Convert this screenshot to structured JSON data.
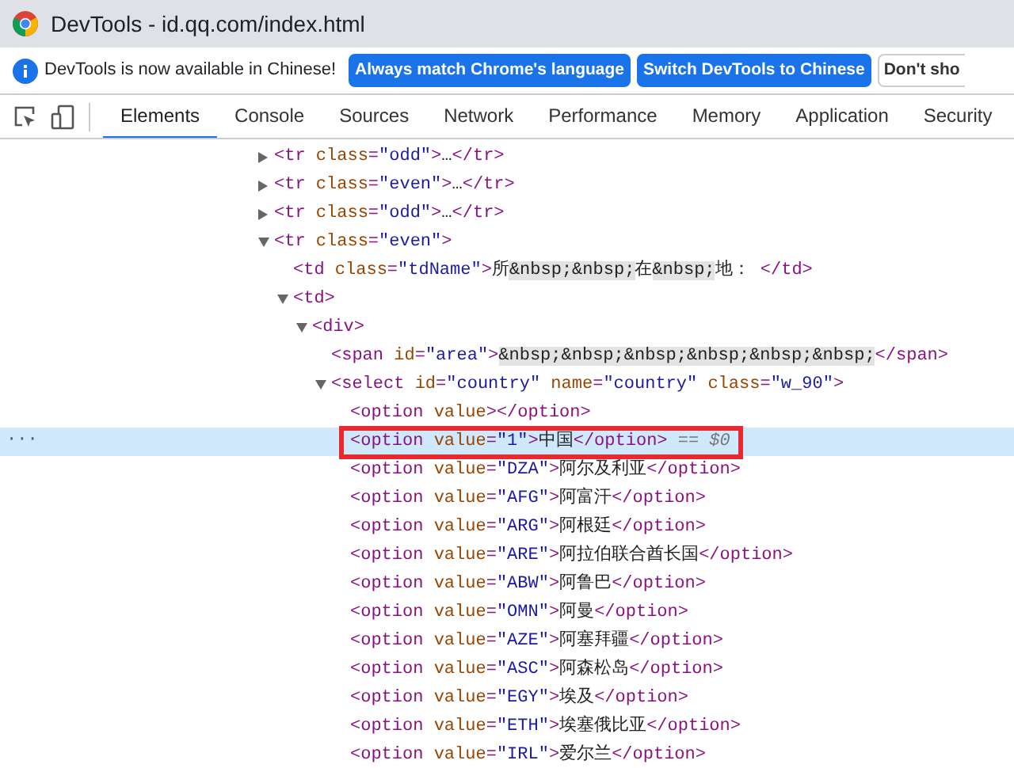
{
  "window": {
    "title": "DevTools - id.qq.com/index.html"
  },
  "infobar": {
    "message": "DevTools is now available in Chinese!",
    "buttons": [
      {
        "label": "Always match Chrome's language",
        "kind": "primary"
      },
      {
        "label": "Switch DevTools to Chinese",
        "kind": "primary"
      },
      {
        "label": "Don't sho",
        "kind": "plain"
      }
    ]
  },
  "tabs": [
    {
      "label": "Elements",
      "selected": true
    },
    {
      "label": "Console",
      "selected": false
    },
    {
      "label": "Sources",
      "selected": false
    },
    {
      "label": "Network",
      "selected": false
    },
    {
      "label": "Performance",
      "selected": false
    },
    {
      "label": "Memory",
      "selected": false
    },
    {
      "label": "Application",
      "selected": false
    },
    {
      "label": "Security",
      "selected": false
    }
  ],
  "tree": [
    {
      "selected": false,
      "expanded": false,
      "segments": [
        {
          "kind": "tag",
          "text": "<tr"
        },
        {
          "kind": "attr",
          "text": " class"
        },
        {
          "kind": "tag",
          "text": "="
        },
        {
          "kind": "value",
          "text": "\"odd\""
        },
        {
          "kind": "tag",
          "text": ">"
        },
        {
          "kind": "text",
          "text": "…"
        },
        {
          "kind": "tag",
          "text": "</tr>"
        }
      ]
    },
    {
      "selected": false,
      "expanded": false,
      "segments": [
        {
          "kind": "tag",
          "text": "<tr"
        },
        {
          "kind": "attr",
          "text": " class"
        },
        {
          "kind": "tag",
          "text": "="
        },
        {
          "kind": "value",
          "text": "\"even\""
        },
        {
          "kind": "tag",
          "text": ">"
        },
        {
          "kind": "text",
          "text": "…"
        },
        {
          "kind": "tag",
          "text": "</tr>"
        }
      ]
    },
    {
      "selected": false,
      "expanded": false,
      "segments": [
        {
          "kind": "tag",
          "text": "<tr"
        },
        {
          "kind": "attr",
          "text": " class"
        },
        {
          "kind": "tag",
          "text": "="
        },
        {
          "kind": "value",
          "text": "\"odd\""
        },
        {
          "kind": "tag",
          "text": ">"
        },
        {
          "kind": "text",
          "text": "…"
        },
        {
          "kind": "tag",
          "text": "</tr>"
        }
      ]
    },
    {
      "selected": false,
      "expanded": true,
      "segments": [
        {
          "kind": "tag",
          "text": "<tr"
        },
        {
          "kind": "attr",
          "text": " class"
        },
        {
          "kind": "tag",
          "text": "="
        },
        {
          "kind": "value",
          "text": "\"even\""
        },
        {
          "kind": "tag",
          "text": ">"
        }
      ],
      "children": [
        {
          "selected": false,
          "segments": [
            {
              "kind": "tag",
              "text": "<td"
            },
            {
              "kind": "attr",
              "text": " class"
            },
            {
              "kind": "tag",
              "text": "="
            },
            {
              "kind": "value",
              "text": "\"tdName\""
            },
            {
              "kind": "tag",
              "text": ">"
            },
            {
              "kind": "text",
              "text": "所"
            },
            {
              "kind": "entity",
              "text": "&nbsp;&nbsp;"
            },
            {
              "kind": "text",
              "text": "在"
            },
            {
              "kind": "entity",
              "text": "&nbsp;"
            },
            {
              "kind": "text",
              "text": "地： "
            },
            {
              "kind": "tag",
              "text": "</td>"
            }
          ]
        },
        {
          "selected": false,
          "expanded": true,
          "segments": [
            {
              "kind": "tag",
              "text": "<td>"
            }
          ],
          "children": [
            {
              "selected": false,
              "expanded": true,
              "segments": [
                {
                  "kind": "tag",
                  "text": "<div>"
                }
              ],
              "children": [
                {
                  "selected": false,
                  "segments": [
                    {
                      "kind": "tag",
                      "text": "<span"
                    },
                    {
                      "kind": "attr",
                      "text": " id"
                    },
                    {
                      "kind": "tag",
                      "text": "="
                    },
                    {
                      "kind": "value",
                      "text": "\"area\""
                    },
                    {
                      "kind": "tag",
                      "text": ">"
                    },
                    {
                      "kind": "entity",
                      "text": "&nbsp;&nbsp;&nbsp;&nbsp;&nbsp;&nbsp;"
                    },
                    {
                      "kind": "tag",
                      "text": "</span>"
                    }
                  ]
                },
                {
                  "selected": false,
                  "expanded": true,
                  "segments": [
                    {
                      "kind": "tag",
                      "text": "<select"
                    },
                    {
                      "kind": "attr",
                      "text": " id"
                    },
                    {
                      "kind": "tag",
                      "text": "="
                    },
                    {
                      "kind": "value",
                      "text": "\"country\""
                    },
                    {
                      "kind": "attr",
                      "text": " name"
                    },
                    {
                      "kind": "tag",
                      "text": "="
                    },
                    {
                      "kind": "value",
                      "text": "\"country\""
                    },
                    {
                      "kind": "attr",
                      "text": " class"
                    },
                    {
                      "kind": "tag",
                      "text": "="
                    },
                    {
                      "kind": "value",
                      "text": "\"w_90\""
                    },
                    {
                      "kind": "tag",
                      "text": ">"
                    }
                  ],
                  "children": [
                    {
                      "selected": false,
                      "segments": [
                        {
                          "kind": "tag",
                          "text": "<option"
                        },
                        {
                          "kind": "attr",
                          "text": " value"
                        },
                        {
                          "kind": "tag",
                          "text": ">"
                        },
                        {
                          "kind": "tag",
                          "text": "</option>"
                        }
                      ]
                    },
                    {
                      "selected": true,
                      "boxed": true,
                      "gutter": "···",
                      "segments": [
                        {
                          "kind": "tag",
                          "text": "<option"
                        },
                        {
                          "kind": "attr",
                          "text": " value"
                        },
                        {
                          "kind": "tag",
                          "text": "="
                        },
                        {
                          "kind": "value",
                          "text": "\"1\""
                        },
                        {
                          "kind": "tag",
                          "text": ">"
                        },
                        {
                          "kind": "text",
                          "text": "中国"
                        },
                        {
                          "kind": "tag",
                          "text": "</option>"
                        },
                        {
                          "kind": "ref",
                          "text": " == $0"
                        }
                      ]
                    },
                    {
                      "selected": false,
                      "segments": [
                        {
                          "kind": "tag",
                          "text": "<option"
                        },
                        {
                          "kind": "attr",
                          "text": " value"
                        },
                        {
                          "kind": "tag",
                          "text": "="
                        },
                        {
                          "kind": "value",
                          "text": "\"DZA\""
                        },
                        {
                          "kind": "tag",
                          "text": ">"
                        },
                        {
                          "kind": "text",
                          "text": "阿尔及利亚"
                        },
                        {
                          "kind": "tag",
                          "text": "</option>"
                        }
                      ]
                    },
                    {
                      "selected": false,
                      "segments": [
                        {
                          "kind": "tag",
                          "text": "<option"
                        },
                        {
                          "kind": "attr",
                          "text": " value"
                        },
                        {
                          "kind": "tag",
                          "text": "="
                        },
                        {
                          "kind": "value",
                          "text": "\"AFG\""
                        },
                        {
                          "kind": "tag",
                          "text": ">"
                        },
                        {
                          "kind": "text",
                          "text": "阿富汗"
                        },
                        {
                          "kind": "tag",
                          "text": "</option>"
                        }
                      ]
                    },
                    {
                      "selected": false,
                      "segments": [
                        {
                          "kind": "tag",
                          "text": "<option"
                        },
                        {
                          "kind": "attr",
                          "text": " value"
                        },
                        {
                          "kind": "tag",
                          "text": "="
                        },
                        {
                          "kind": "value",
                          "text": "\"ARG\""
                        },
                        {
                          "kind": "tag",
                          "text": ">"
                        },
                        {
                          "kind": "text",
                          "text": "阿根廷"
                        },
                        {
                          "kind": "tag",
                          "text": "</option>"
                        }
                      ]
                    },
                    {
                      "selected": false,
                      "segments": [
                        {
                          "kind": "tag",
                          "text": "<option"
                        },
                        {
                          "kind": "attr",
                          "text": " value"
                        },
                        {
                          "kind": "tag",
                          "text": "="
                        },
                        {
                          "kind": "value",
                          "text": "\"ARE\""
                        },
                        {
                          "kind": "tag",
                          "text": ">"
                        },
                        {
                          "kind": "text",
                          "text": "阿拉伯联合酋长国"
                        },
                        {
                          "kind": "tag",
                          "text": "</option>"
                        }
                      ]
                    },
                    {
                      "selected": false,
                      "segments": [
                        {
                          "kind": "tag",
                          "text": "<option"
                        },
                        {
                          "kind": "attr",
                          "text": " value"
                        },
                        {
                          "kind": "tag",
                          "text": "="
                        },
                        {
                          "kind": "value",
                          "text": "\"ABW\""
                        },
                        {
                          "kind": "tag",
                          "text": ">"
                        },
                        {
                          "kind": "text",
                          "text": "阿鲁巴"
                        },
                        {
                          "kind": "tag",
                          "text": "</option>"
                        }
                      ]
                    },
                    {
                      "selected": false,
                      "segments": [
                        {
                          "kind": "tag",
                          "text": "<option"
                        },
                        {
                          "kind": "attr",
                          "text": " value"
                        },
                        {
                          "kind": "tag",
                          "text": "="
                        },
                        {
                          "kind": "value",
                          "text": "\"OMN\""
                        },
                        {
                          "kind": "tag",
                          "text": ">"
                        },
                        {
                          "kind": "text",
                          "text": "阿曼"
                        },
                        {
                          "kind": "tag",
                          "text": "</option>"
                        }
                      ]
                    },
                    {
                      "selected": false,
                      "segments": [
                        {
                          "kind": "tag",
                          "text": "<option"
                        },
                        {
                          "kind": "attr",
                          "text": " value"
                        },
                        {
                          "kind": "tag",
                          "text": "="
                        },
                        {
                          "kind": "value",
                          "text": "\"AZE\""
                        },
                        {
                          "kind": "tag",
                          "text": ">"
                        },
                        {
                          "kind": "text",
                          "text": "阿塞拜疆"
                        },
                        {
                          "kind": "tag",
                          "text": "</option>"
                        }
                      ]
                    },
                    {
                      "selected": false,
                      "segments": [
                        {
                          "kind": "tag",
                          "text": "<option"
                        },
                        {
                          "kind": "attr",
                          "text": " value"
                        },
                        {
                          "kind": "tag",
                          "text": "="
                        },
                        {
                          "kind": "value",
                          "text": "\"ASC\""
                        },
                        {
                          "kind": "tag",
                          "text": ">"
                        },
                        {
                          "kind": "text",
                          "text": "阿森松岛"
                        },
                        {
                          "kind": "tag",
                          "text": "</option>"
                        }
                      ]
                    },
                    {
                      "selected": false,
                      "segments": [
                        {
                          "kind": "tag",
                          "text": "<option"
                        },
                        {
                          "kind": "attr",
                          "text": " value"
                        },
                        {
                          "kind": "tag",
                          "text": "="
                        },
                        {
                          "kind": "value",
                          "text": "\"EGY\""
                        },
                        {
                          "kind": "tag",
                          "text": ">"
                        },
                        {
                          "kind": "text",
                          "text": "埃及"
                        },
                        {
                          "kind": "tag",
                          "text": "</option>"
                        }
                      ]
                    },
                    {
                      "selected": false,
                      "segments": [
                        {
                          "kind": "tag",
                          "text": "<option"
                        },
                        {
                          "kind": "attr",
                          "text": " value"
                        },
                        {
                          "kind": "tag",
                          "text": "="
                        },
                        {
                          "kind": "value",
                          "text": "\"ETH\""
                        },
                        {
                          "kind": "tag",
                          "text": ">"
                        },
                        {
                          "kind": "text",
                          "text": "埃塞俄比亚"
                        },
                        {
                          "kind": "tag",
                          "text": "</option>"
                        }
                      ]
                    },
                    {
                      "selected": false,
                      "segments": [
                        {
                          "kind": "tag",
                          "text": "<option"
                        },
                        {
                          "kind": "attr",
                          "text": " value"
                        },
                        {
                          "kind": "tag",
                          "text": "="
                        },
                        {
                          "kind": "value",
                          "text": "\"IRL\""
                        },
                        {
                          "kind": "tag",
                          "text": ">"
                        },
                        {
                          "kind": "text",
                          "text": "爱尔兰"
                        },
                        {
                          "kind": "tag",
                          "text": "</option>"
                        }
                      ]
                    }
                  ]
                }
              ]
            }
          ]
        }
      ]
    }
  ]
}
